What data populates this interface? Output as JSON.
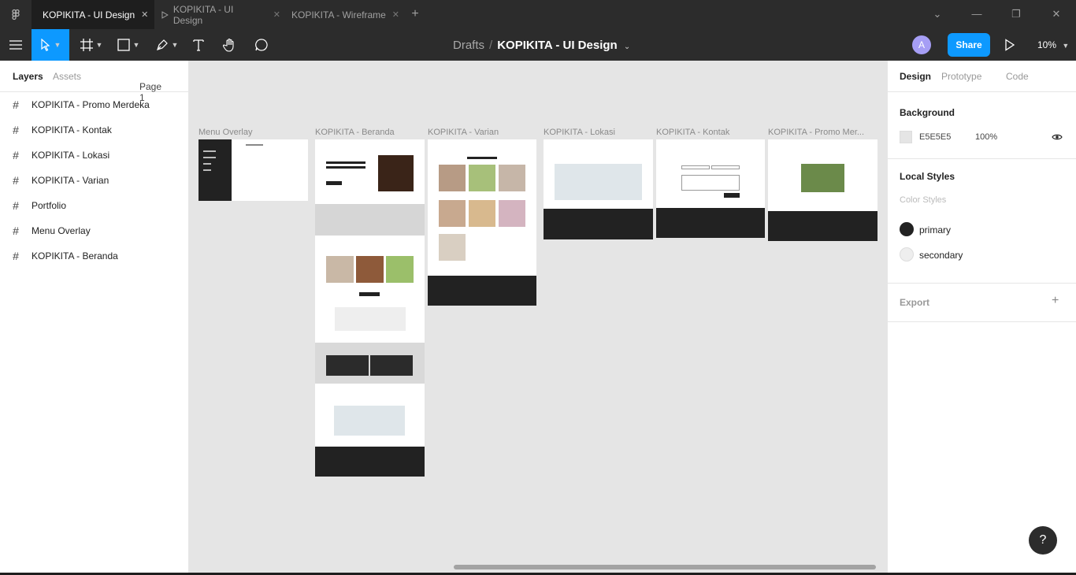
{
  "titlebar": {
    "tabs": [
      {
        "label": "KOPIKITA - UI Design",
        "active": true
      },
      {
        "label": "KOPIKITA - UI Design",
        "active": false,
        "prefix_icon": "play-icon"
      },
      {
        "label": "KOPIKITA - Wireframe",
        "active": false
      }
    ],
    "new_tab": "+",
    "window_controls": {
      "minimize": "—",
      "restore": "❐",
      "close": "✕",
      "dropdown": "⌄"
    }
  },
  "toolbar": {
    "breadcrumb_root": "Drafts",
    "breadcrumb_sep": "/",
    "file_name": "KOPIKITA - UI Design",
    "avatar_letter": "A",
    "share_label": "Share",
    "zoom": "10%"
  },
  "left_panel": {
    "tab_layers": "Layers",
    "tab_assets": "Assets",
    "page": "Page 1",
    "layers": [
      "KOPIKITA - Promo Merdeka",
      "KOPIKITA - Kontak",
      "KOPIKITA - Lokasi",
      "KOPIKITA - Varian",
      "Portfolio",
      "Menu Overlay",
      "KOPIKITA - Beranda"
    ]
  },
  "canvas": {
    "frames": [
      "Menu Overlay",
      "KOPIKITA - Beranda",
      "KOPIKITA - Varian",
      "KOPIKITA - Lokasi",
      "KOPIKITA - Kontak",
      "KOPIKITA - Promo Mer..."
    ],
    "background": "#E5E5E5"
  },
  "right_panel": {
    "tab_design": "Design",
    "tab_prototype": "Prototype",
    "tab_code": "Code",
    "background_title": "Background",
    "background_hex": "E5E5E5",
    "background_opacity": "100%",
    "local_styles_title": "Local Styles",
    "color_styles_label": "Color Styles",
    "styles": [
      {
        "name": "primary",
        "color": "#222222"
      },
      {
        "name": "secondary",
        "color": "#EEEEEE"
      }
    ],
    "export_title": "Export",
    "export_add": "+"
  },
  "help": "?"
}
